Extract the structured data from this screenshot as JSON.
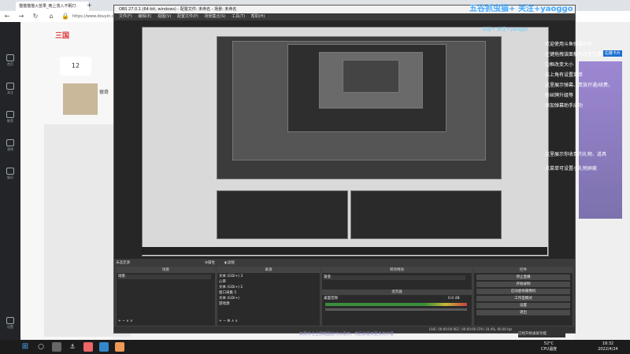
{
  "browser": {
    "tab_title": "猫猫猫猫火苗果_晚上落入不眠灯·",
    "url": "https://www.douyin.com/"
  },
  "left_panel": {
    "logo": "三国",
    "count": "12",
    "text": "很奇"
  },
  "sidebar": {
    "items": [
      "首页",
      "关注",
      "推荐",
      "游戏",
      "娱乐",
      "设置"
    ]
  },
  "obs": {
    "title": "OBS 27.0.1 (64-bit, windows) - 配置文件: 未命名 - 场景: 未命名",
    "menu": [
      "文件(F)",
      "编辑(E)",
      "视图(V)",
      "配置文件(P)",
      "场景集合(S)",
      "工具(T)",
      "帮助(H)"
    ],
    "not_live": "未选定源",
    "properties_label": "属性",
    "filters_label": "滤镜",
    "docks": {
      "scenes": {
        "title": "场景",
        "items": [
          "场景"
        ]
      },
      "sources": {
        "title": "来源",
        "items": [
          "文本 (GDI+) 3",
          "心率",
          "文本 (GDI+) 2",
          "窗口采集 5",
          "文本 (GDI+)",
          "游戏源"
        ]
      },
      "mixer": {
        "title": "混音器",
        "device": "桌面音频",
        "level": "0.0 dB"
      },
      "transitions": {
        "title": "转场特效",
        "type": "渐变"
      },
      "controls": {
        "title": "控件",
        "buttons": [
          "停止直播",
          "开始录制",
          "启动虚拟摄像机",
          "工作室模式",
          "设置",
          "退出"
        ]
      }
    },
    "status": "LIVE: 00:00:00   REC: 00:00:00   CPU: 10.4%, 60.00 fps"
  },
  "overlay": {
    "title": "五谷抓虫猫+ 关注+yaoggo",
    "sub": "五谷+ 关注+yaoggo",
    "badge": "右键卡片",
    "tips": [
      "欢迎使用斗鱼弹幕助手",
      "左键拖拽该面板可改变位置",
      "边框改变大小",
      "右上角有设置菜单",
      "这里展示弹幕、贵族开通/续费，",
      "粉丝牌升级等",
      "添加弹幕助手成功"
    ],
    "tips2": [
      "这里展示你收到的礼物、道具",
      "点菜单可设置小礼物屏蔽"
    ],
    "bottom_note": "如果你也全屏截图就可以看到，然后就看到更多的字幕",
    "chat_note": "已经开始录屏功能"
  },
  "taskbar": {
    "temp": "52°C",
    "cpu": "CPU温度",
    "time": "18:32",
    "date": "2022/4/24"
  }
}
